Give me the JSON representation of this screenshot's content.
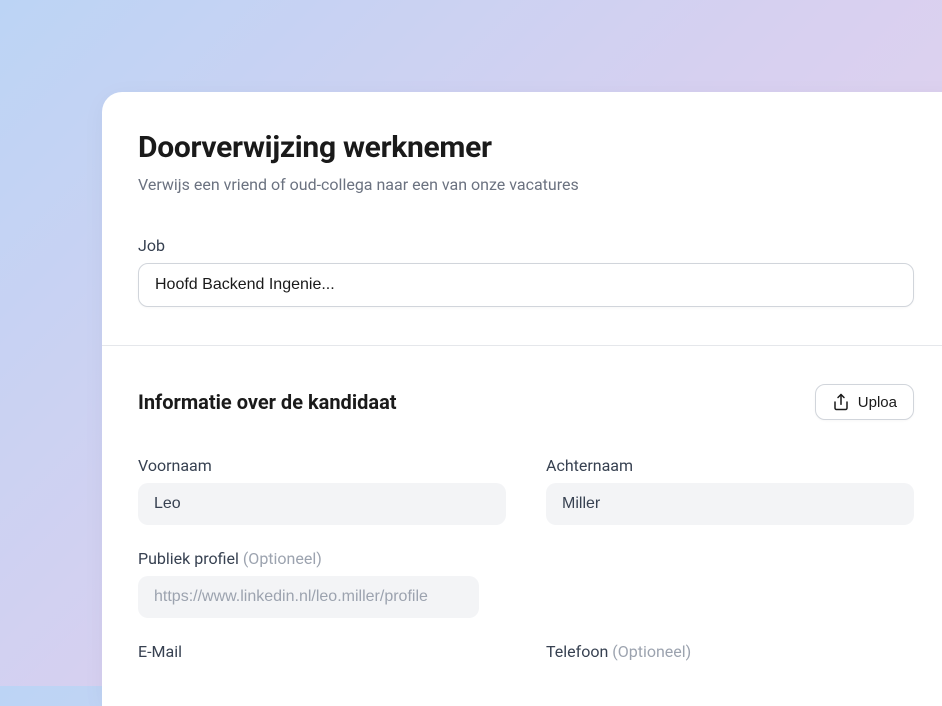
{
  "header": {
    "title": "Doorverwijzing werknemer",
    "subtitle": "Verwijs een vriend of oud-collega naar een van onze vacatures"
  },
  "job": {
    "label": "Job",
    "selected": "Hoofd Backend Ingenie..."
  },
  "candidate": {
    "section_title": "Informatie over de kandidaat",
    "upload_label": "Uploa",
    "first_name_label": "Voornaam",
    "first_name_value": "Leo",
    "last_name_label": "Achternaam",
    "last_name_value": "Miller",
    "profile_label": "Publiek profiel",
    "profile_optional": "(Optioneel)",
    "profile_placeholder": "https://www.linkedin.nl/leo.miller/profile",
    "email_label": "E-Mail",
    "phone_label": "Telefoon",
    "phone_optional": "(Optioneel)"
  }
}
